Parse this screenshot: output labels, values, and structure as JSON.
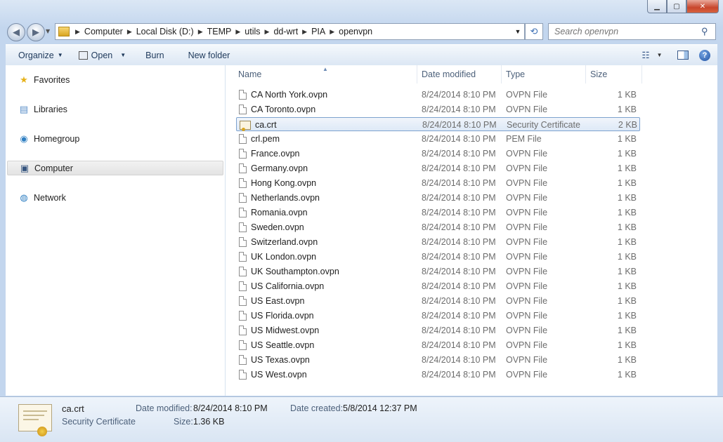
{
  "window": {
    "caption_buttons": {
      "minimize": "▁",
      "maximize": "▢",
      "close": "✕"
    }
  },
  "address_bar": {
    "segments": [
      "Computer",
      "Local Disk (D:)",
      "TEMP",
      "utils",
      "dd-wrt",
      "PIA",
      "openvpn"
    ]
  },
  "search": {
    "placeholder": "Search openvpn"
  },
  "toolbar": {
    "organize": "Organize",
    "open": "Open",
    "burn": "Burn",
    "new_folder": "New folder"
  },
  "nav_pane": {
    "items": [
      {
        "label": "Favorites",
        "icon": "star-icon"
      },
      {
        "label": "Libraries",
        "icon": "libraries-icon"
      },
      {
        "label": "Homegroup",
        "icon": "homegroup-icon"
      },
      {
        "label": "Computer",
        "icon": "computer-icon",
        "selected": true
      },
      {
        "label": "Network",
        "icon": "network-icon"
      }
    ]
  },
  "columns": {
    "name": "Name",
    "date": "Date modified",
    "type": "Type",
    "size": "Size"
  },
  "files": [
    {
      "name": "CA North York.ovpn",
      "date": "8/24/2014 8:10 PM",
      "type": "OVPN File",
      "size": "1 KB"
    },
    {
      "name": "CA Toronto.ovpn",
      "date": "8/24/2014 8:10 PM",
      "type": "OVPN File",
      "size": "1 KB"
    },
    {
      "name": "ca.crt",
      "date": "8/24/2014 8:10 PM",
      "type": "Security Certificate",
      "size": "2 KB",
      "selected": true
    },
    {
      "name": "crl.pem",
      "date": "8/24/2014 8:10 PM",
      "type": "PEM File",
      "size": "1 KB"
    },
    {
      "name": "France.ovpn",
      "date": "8/24/2014 8:10 PM",
      "type": "OVPN File",
      "size": "1 KB"
    },
    {
      "name": "Germany.ovpn",
      "date": "8/24/2014 8:10 PM",
      "type": "OVPN File",
      "size": "1 KB"
    },
    {
      "name": "Hong Kong.ovpn",
      "date": "8/24/2014 8:10 PM",
      "type": "OVPN File",
      "size": "1 KB"
    },
    {
      "name": "Netherlands.ovpn",
      "date": "8/24/2014 8:10 PM",
      "type": "OVPN File",
      "size": "1 KB"
    },
    {
      "name": "Romania.ovpn",
      "date": "8/24/2014 8:10 PM",
      "type": "OVPN File",
      "size": "1 KB"
    },
    {
      "name": "Sweden.ovpn",
      "date": "8/24/2014 8:10 PM",
      "type": "OVPN File",
      "size": "1 KB"
    },
    {
      "name": "Switzerland.ovpn",
      "date": "8/24/2014 8:10 PM",
      "type": "OVPN File",
      "size": "1 KB"
    },
    {
      "name": "UK London.ovpn",
      "date": "8/24/2014 8:10 PM",
      "type": "OVPN File",
      "size": "1 KB"
    },
    {
      "name": "UK Southampton.ovpn",
      "date": "8/24/2014 8:10 PM",
      "type": "OVPN File",
      "size": "1 KB"
    },
    {
      "name": "US California.ovpn",
      "date": "8/24/2014 8:10 PM",
      "type": "OVPN File",
      "size": "1 KB"
    },
    {
      "name": "US East.ovpn",
      "date": "8/24/2014 8:10 PM",
      "type": "OVPN File",
      "size": "1 KB"
    },
    {
      "name": "US Florida.ovpn",
      "date": "8/24/2014 8:10 PM",
      "type": "OVPN File",
      "size": "1 KB"
    },
    {
      "name": "US Midwest.ovpn",
      "date": "8/24/2014 8:10 PM",
      "type": "OVPN File",
      "size": "1 KB"
    },
    {
      "name": "US Seattle.ovpn",
      "date": "8/24/2014 8:10 PM",
      "type": "OVPN File",
      "size": "1 KB"
    },
    {
      "name": "US Texas.ovpn",
      "date": "8/24/2014 8:10 PM",
      "type": "OVPN File",
      "size": "1 KB"
    },
    {
      "name": "US West.ovpn",
      "date": "8/24/2014 8:10 PM",
      "type": "OVPN File",
      "size": "1 KB"
    }
  ],
  "details": {
    "name": "ca.crt",
    "type": "Security Certificate",
    "date_modified_label": "Date modified:",
    "date_modified": "8/24/2014 8:10 PM",
    "date_created_label": "Date created:",
    "date_created": "5/8/2014 12:37 PM",
    "size_label": "Size:",
    "size": "1.36 KB"
  },
  "colors": {
    "selection_border": "#7da2ce",
    "window_frame": "#c3d6ee",
    "accent": "#1e395b"
  }
}
